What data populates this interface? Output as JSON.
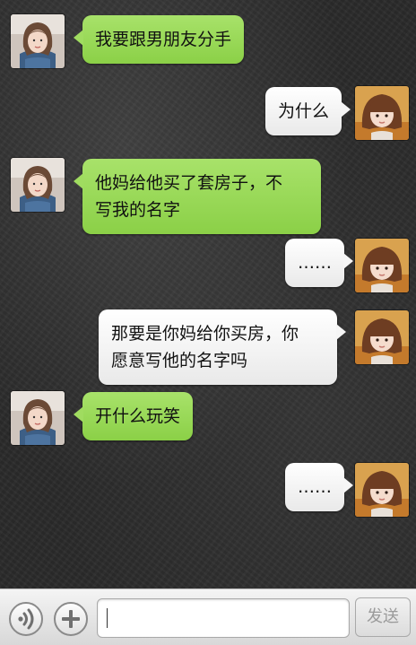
{
  "messages": [
    {
      "sender": "girlfriend",
      "text": "我要跟男朋友分手"
    },
    {
      "sender": "mother",
      "text": "为什么"
    },
    {
      "sender": "girlfriend",
      "line1": "他妈给他买了套房子，不",
      "line2": "写我的名字"
    },
    {
      "sender": "mother",
      "text": "……"
    },
    {
      "sender": "mother",
      "line1": "那要是你妈给你买房，你",
      "line2": "愿意写他的名字吗"
    },
    {
      "sender": "girlfriend",
      "text": "开什么玩笑"
    },
    {
      "sender": "mother",
      "text": "……"
    }
  ],
  "input_bar": {
    "text_value": "",
    "send_label": "发送"
  },
  "colors": {
    "incoming_bubble": "#9ad95a",
    "outgoing_bubble": "#f4f4f4",
    "background": "#2a2a2a"
  },
  "icons": [
    "voice-icon",
    "plus-icon"
  ]
}
